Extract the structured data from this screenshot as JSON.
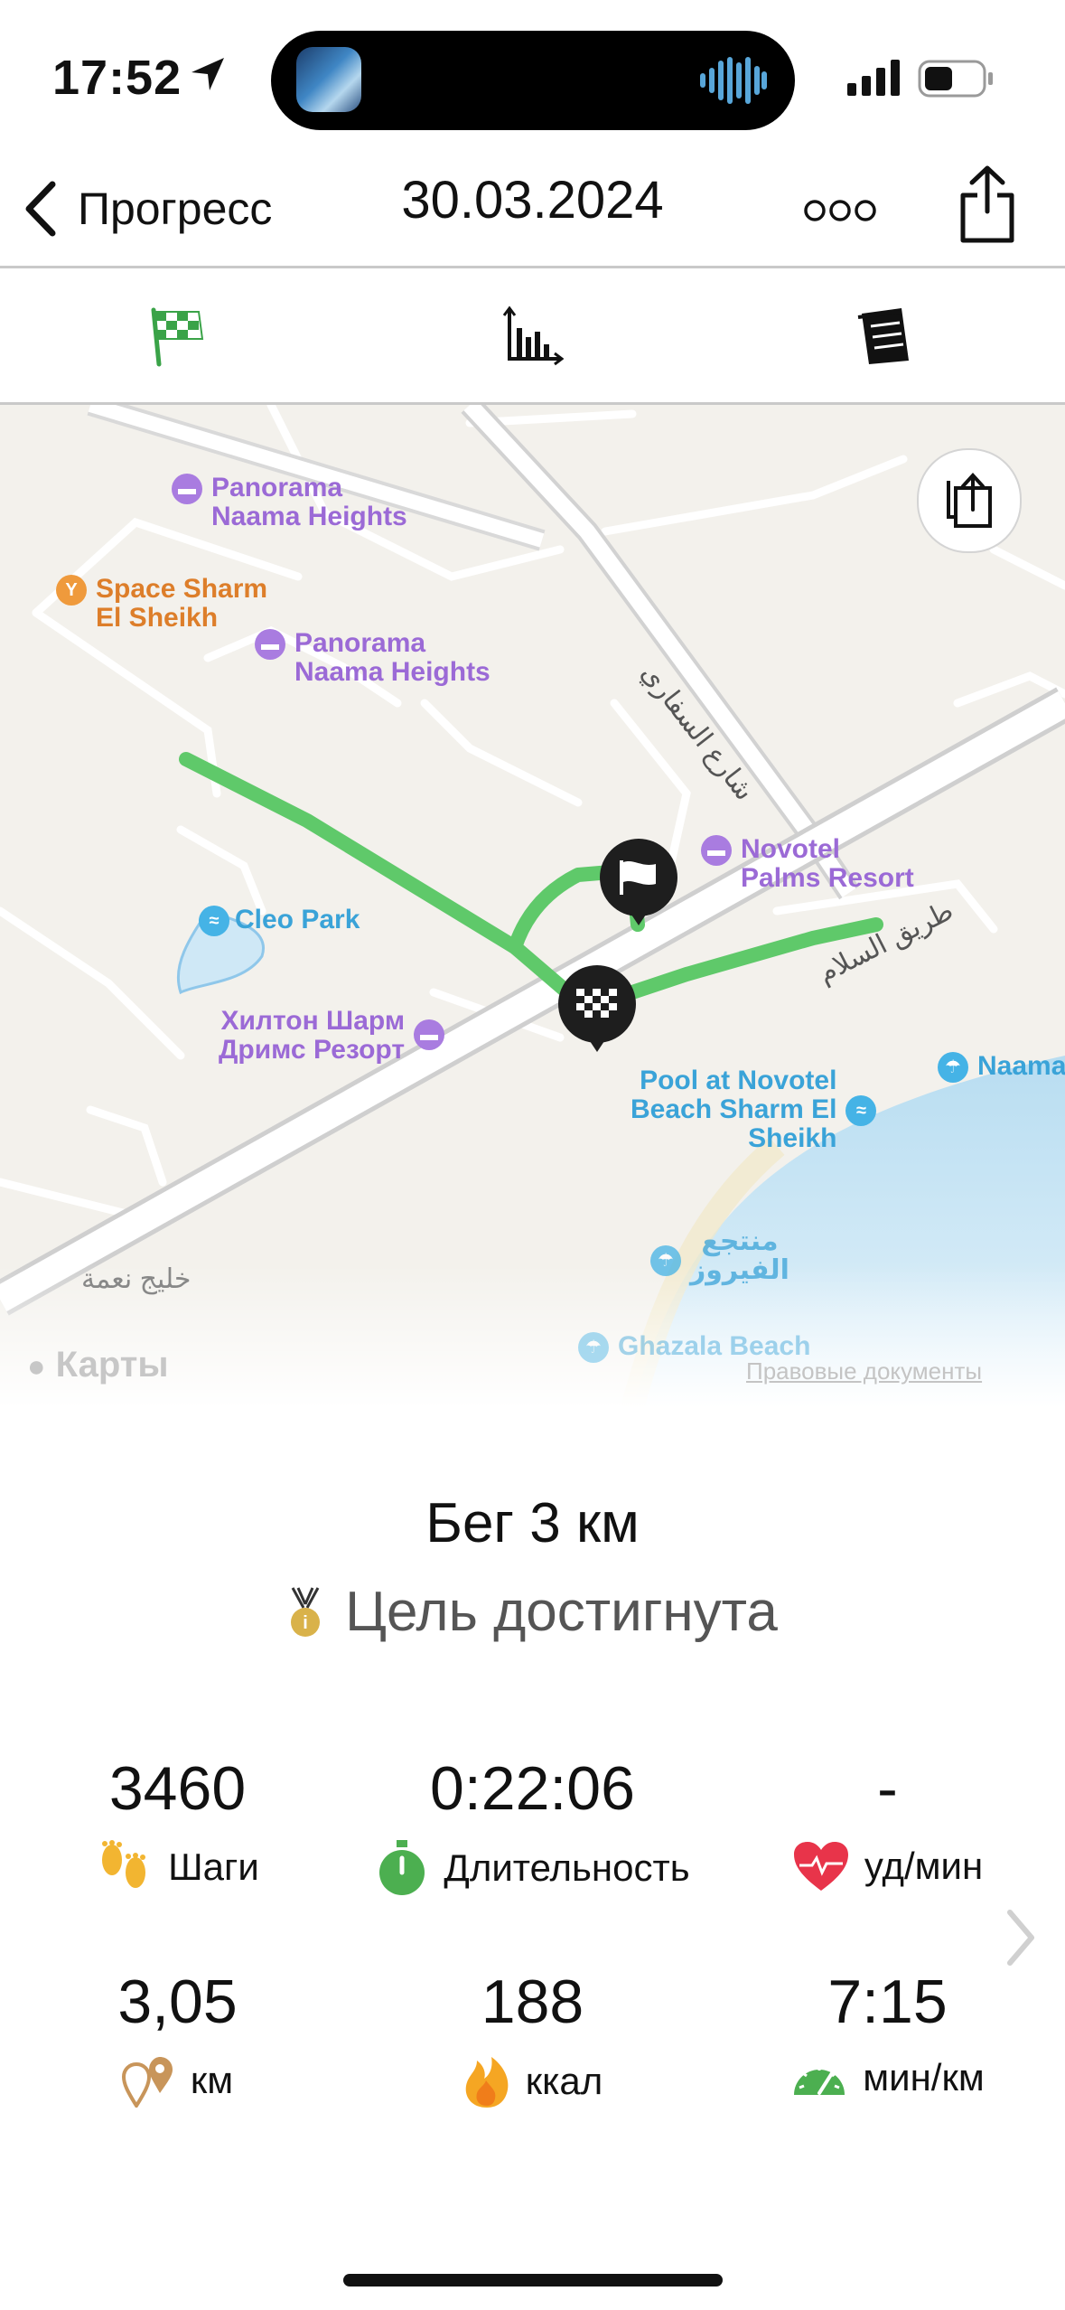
{
  "status_bar": {
    "time": "17:52"
  },
  "nav": {
    "back_label": "Прогресс",
    "title": "30.03.2024"
  },
  "tabs": [
    "finish-flag",
    "stats-chart",
    "notes"
  ],
  "map": {
    "pois": [
      {
        "name": "Panorama\nNaama Heights",
        "category": "hotel"
      },
      {
        "name": "Space Sharm\nEl Sheikh",
        "category": "nightlife"
      },
      {
        "name": "Panorama\nNaama Heights",
        "category": "hotel"
      },
      {
        "name": "Novotel\nPalms Resort",
        "category": "hotel"
      },
      {
        "name": "Cleo Park",
        "category": "water-park"
      },
      {
        "name": "Хилтон Шарм\nДримс Резорт",
        "category": "hotel"
      },
      {
        "name": "Pool at Novotel\nBeach Sharm El\nSheikh",
        "category": "pool"
      },
      {
        "name": "Naama",
        "category": "beach"
      },
      {
        "name": "منتجع\nالفيروز",
        "category": "beach"
      },
      {
        "name": "Ghazala Beach",
        "category": "beach"
      }
    ],
    "streets": [
      "شارع السفاري",
      "طريق السلام",
      "خليج نعمة"
    ],
    "attribution": "Карты",
    "legal_link": "Правовые документы"
  },
  "activity": {
    "title": "Бег 3 км",
    "goal_status": "Цель достигнута"
  },
  "stats": [
    {
      "value": "3460",
      "label": "Шаги",
      "icon": "footprints-icon"
    },
    {
      "value": "0:22:06",
      "label": "Длительность",
      "icon": "stopwatch-icon"
    },
    {
      "value": "-",
      "label": "уд/мин",
      "icon": "heart-icon"
    },
    {
      "value": "3,05",
      "label": "км",
      "icon": "location-pins-icon"
    },
    {
      "value": "188",
      "label": "ккал",
      "icon": "flame-icon"
    },
    {
      "value": "7:15",
      "label": "мин/км",
      "icon": "speedometer-icon"
    }
  ],
  "colors": {
    "route": "#5fc96a",
    "accent_green": "#4caf50",
    "heart": "#e8344a"
  }
}
